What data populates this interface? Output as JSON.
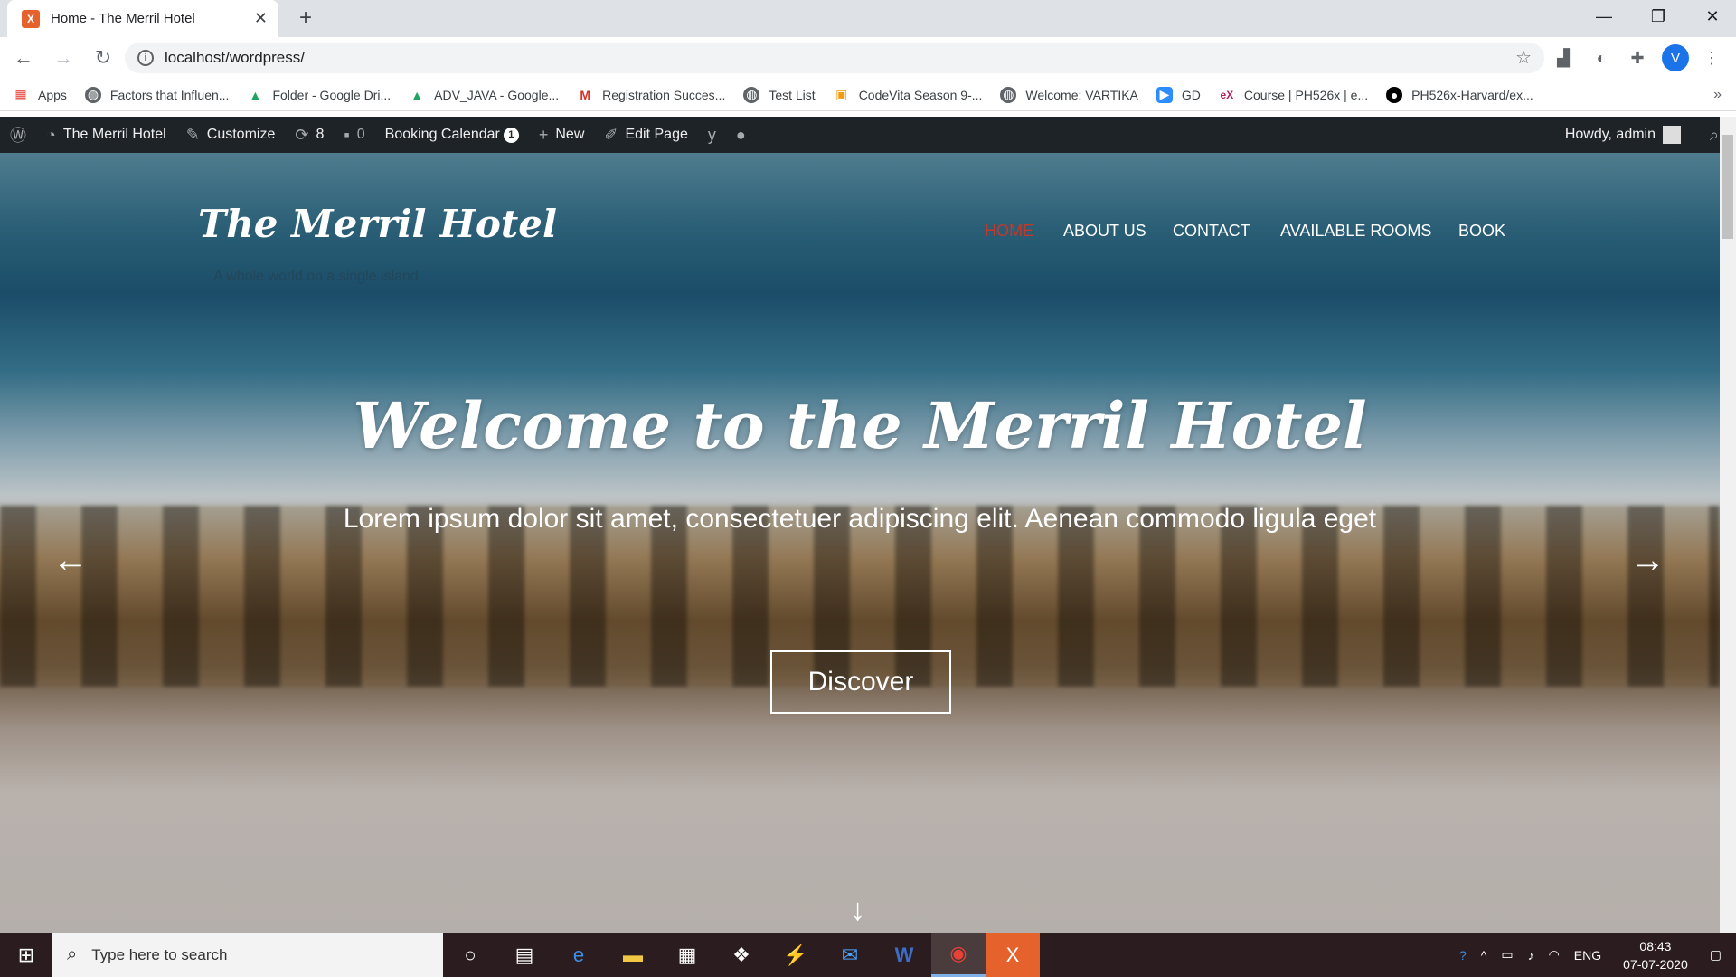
{
  "browser": {
    "tab_title": "Home - The Merril Hotel",
    "tab_favicon": "xampp-icon",
    "url": "localhost/wordpress/",
    "profile_initial": "V"
  },
  "bookmarks": [
    {
      "label": "Apps",
      "icon": "apps-grid-icon"
    },
    {
      "label": "Factors that Influen...",
      "icon": "globe-icon"
    },
    {
      "label": "Folder - Google Dri...",
      "icon": "google-drive-icon"
    },
    {
      "label": "ADV_JAVA - Google...",
      "icon": "google-drive-icon"
    },
    {
      "label": "Registration Succes...",
      "icon": "gmail-icon"
    },
    {
      "label": "Test List",
      "icon": "globe-icon"
    },
    {
      "label": "CodeVita Season 9-...",
      "icon": "codevita-icon"
    },
    {
      "label": "Welcome: VARTIKA",
      "icon": "globe-icon"
    },
    {
      "label": "GD",
      "icon": "zoom-icon"
    },
    {
      "label": "Course | PH526x | e...",
      "icon": "edx-icon"
    },
    {
      "label": "PH526x-Harvard/ex...",
      "icon": "github-icon"
    }
  ],
  "wp_admin_bar": {
    "site_name": "The Merril Hotel",
    "customize": "Customize",
    "updates": "8",
    "comments": "0",
    "booking_calendar": "Booking Calendar",
    "booking_badge": "1",
    "new": "New",
    "edit_page": "Edit Page",
    "howdy": "Howdy, admin"
  },
  "site": {
    "title": "The Merril Hotel",
    "tagline": "A whole world on a single island",
    "menu": [
      "HOME",
      "ABOUT US",
      "CONTACT",
      "AVAILABLE ROOMS",
      "BOOK"
    ],
    "active_menu": "HOME"
  },
  "hero": {
    "title": "Welcome to the Merril Hotel",
    "subtitle": "Lorem ipsum dolor sit amet, consectetuer adipiscing elit. Aenean commodo ligula eget",
    "button": "Discover"
  },
  "taskbar": {
    "search_placeholder": "Type here to search",
    "language": "ENG",
    "time": "08:43",
    "date": "07-07-2020"
  },
  "colors": {
    "wp_admin_bar": "#1d2327",
    "menu_active": "#c0392b",
    "taskbar": "#2b1d1f"
  }
}
